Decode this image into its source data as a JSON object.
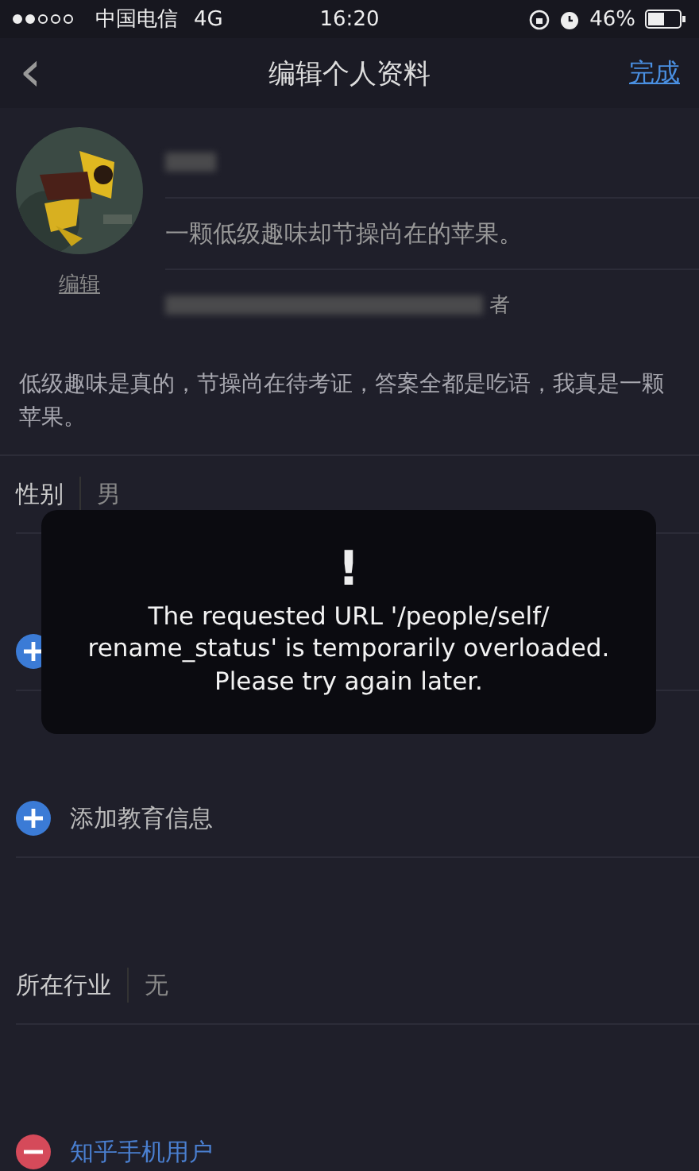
{
  "status_bar": {
    "carrier": "中国电信",
    "network": "4G",
    "time": "16:20",
    "battery": "46%"
  },
  "nav": {
    "back": "‹",
    "title": "编辑个人资料",
    "done": "完成"
  },
  "profile": {
    "edit_link": "编辑",
    "headline": "一颗低级趣味却节操尚在的苹果。",
    "trailing": "者"
  },
  "bio": "低级趣味是真的，节操尚在待考证，答案全都是吃语，我真是一颗苹果。",
  "gender": {
    "label": "性别",
    "value": "男"
  },
  "add_education": "添加教育信息",
  "industry": {
    "label": "所在行业",
    "value": "无"
  },
  "account": "知乎手机用户",
  "toast": {
    "mark": "!",
    "message": "The requested URL '/people/self/ rename_status' is temporarily overloaded. Please try again later."
  }
}
